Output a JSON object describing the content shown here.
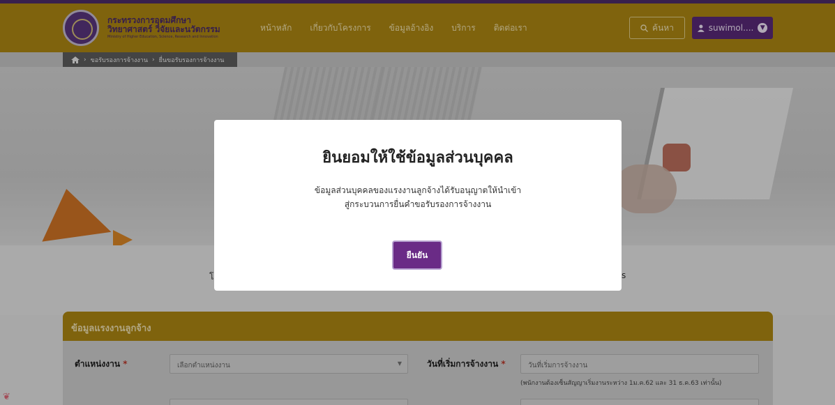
{
  "header": {
    "org_line1": "กระทรวงการอุดมศึกษา",
    "org_line2": "วิทยาศาสตร์ วิจัยและนวัตกรรม",
    "org_line3": "Ministry of Higher Education, Science, Research and Innovation",
    "nav": [
      "หน้าหลัก",
      "เกี่ยวกับโครงการ",
      "ข้อมูลอ้างอิง",
      "บริการ",
      "ติดต่อเรา"
    ],
    "search_label": "ค้นหา",
    "user_label": "suwimol....",
    "search_icon": "search-icon",
    "user_icon": "user-icon",
    "colors": {
      "bar": "#b18a13",
      "accent": "#4e2d6b",
      "user_btn": "#5b2a7a"
    }
  },
  "breadcrumb": {
    "home_icon": "home-icon",
    "items": [
      "ขอรับรองการจ้างงาน",
      "ยื่นขอรับรองการจ้างงาน"
    ]
  },
  "background_text": {
    "left": "โ",
    "right": "s"
  },
  "form": {
    "section_title": "ข้อมูลแรงงานลูกจ้าง",
    "position_label": "ตำแหน่งงาน",
    "required_mark": "*",
    "position_placeholder": "เลือกตำแหน่งงาน",
    "start_date_label": "วันที่เริ่มการจ้างงาน",
    "start_date_placeholder": "วันที่เริ่มการจ้างงาน",
    "start_date_hint": "(พนักงานต้องเซ็นสัญญาเริ่มงานระหว่าง 1ม.ค.62 และ 31 ธ.ค.63 เท่านั้น)"
  },
  "modal": {
    "title": "ยินยอมให้ใช้ข้อมูลส่วนบุคคล",
    "body_line1": "ข้อมูลส่วนบุคคลของแรงงานลูกจ้างได้รับอนุญาตให้นำเข้า",
    "body_line2": "สู่กระบวนการยื่นคำขอรับรองการจ้างงาน",
    "confirm_label": "ยืนยัน",
    "confirm_color": "#6a2b86"
  }
}
